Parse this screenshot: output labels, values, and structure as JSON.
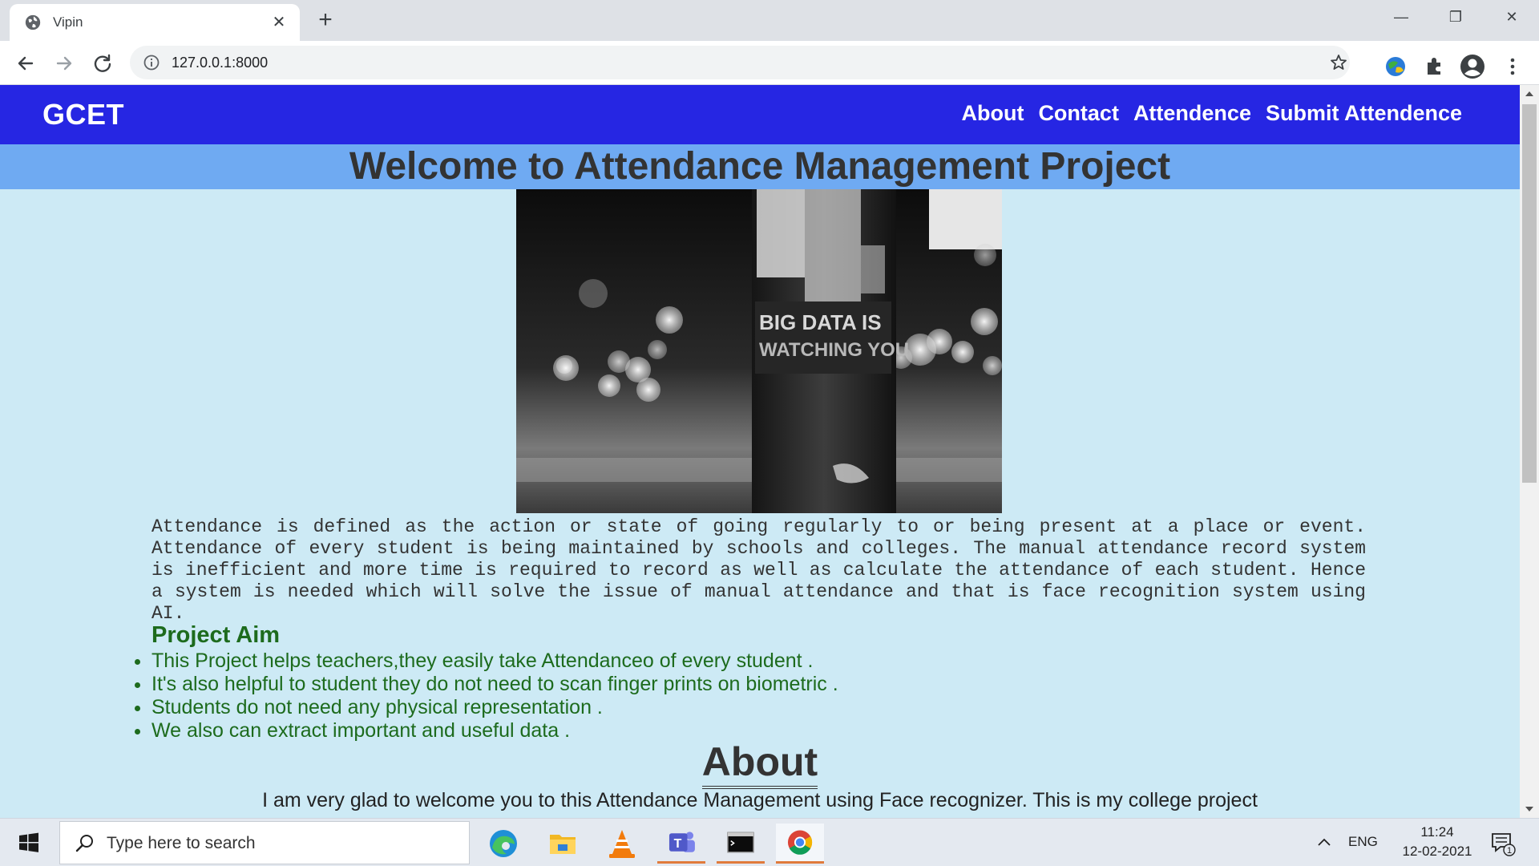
{
  "browser": {
    "tab_title": "Vipin",
    "tab_close": "✕",
    "new_tab": "+",
    "url": "127.0.0.1:8000",
    "window_controls": {
      "minimize": "—",
      "maximize": "❐",
      "close": "✕"
    }
  },
  "site": {
    "brand": "GCET",
    "nav": [
      "About",
      "Contact",
      "Attendence",
      "Submit Attendence"
    ],
    "hero_title": "Welcome to Attendance Management Project",
    "intro": "Attendance is defined as the action or state of going regularly to or being present at a place or event. Attendance of every student is being maintained by schools and colleges. The manual attendance record system is inefficient and more time is required to record as well as calculate the attendance of each student. Hence a system is needed which will solve the issue of manual attendance and that is face recognition system using AI.",
    "aim_heading": "Project Aim",
    "aims": [
      "This Project helps teachers,they easily take Attendanceo of every student .",
      "It's also helpful to student they do not need to scan finger prints on biometric .",
      "Students do not need any physical representation .",
      "We also can extract important and useful data ."
    ],
    "about_heading": "About",
    "about_text": "I am very glad to welcome you to this Attendance Management using Face recognizer. This is my college project",
    "image_text": "BIG DATA IS WATCHING YOU",
    "colors": {
      "navbar": "#2626e3",
      "hero": "#6faaf2",
      "page_bg": "#cdeaf5",
      "aim_text": "#1d6b1d"
    }
  },
  "taskbar": {
    "search_placeholder": "Type here to search",
    "apps": [
      "edge-icon",
      "file-explorer-icon",
      "vlc-icon",
      "teams-icon",
      "terminal-icon",
      "chrome-icon"
    ],
    "lang": "ENG",
    "time": "11:24",
    "date": "12-02-2021",
    "notification_count": "1"
  }
}
